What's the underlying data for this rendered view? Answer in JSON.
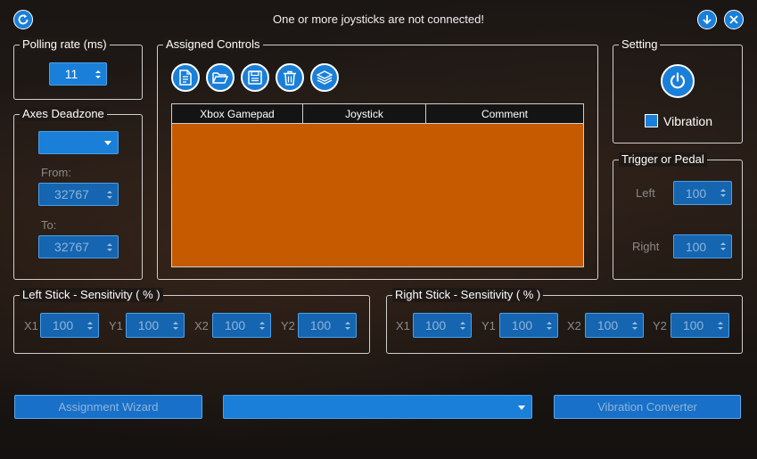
{
  "window": {
    "status_message": "One or more joysticks are not connected!"
  },
  "polling": {
    "title": "Polling rate (ms)",
    "value": "11"
  },
  "deadzone": {
    "title": "Axes Deadzone",
    "combo_value": "",
    "from_label": "From:",
    "from_value": "32767",
    "to_label": "To:",
    "to_value": "32767"
  },
  "assigned": {
    "title": "Assigned Controls",
    "toolbar": [
      {
        "icon": "new-document-icon"
      },
      {
        "icon": "open-folder-icon"
      },
      {
        "icon": "save-icon"
      },
      {
        "icon": "delete-icon"
      },
      {
        "icon": "layers-icon"
      }
    ],
    "columns": [
      "Xbox Gamepad",
      "Joystick",
      "Comment"
    ],
    "rows": []
  },
  "setting": {
    "title": "Setting",
    "vibration_label": "Vibration",
    "vibration_checked": false
  },
  "trigger": {
    "title": "Trigger or Pedal",
    "left_label": "Left",
    "left_value": "100",
    "right_label": "Right",
    "right_value": "100"
  },
  "left_stick": {
    "title": "Left Stick - Sensitivity ( % )",
    "fields": [
      {
        "label": "X1",
        "value": "100"
      },
      {
        "label": "Y1",
        "value": "100"
      },
      {
        "label": "X2",
        "value": "100"
      },
      {
        "label": "Y2",
        "value": "100"
      }
    ]
  },
  "right_stick": {
    "title": "Right Stick - Sensitivity ( % )",
    "fields": [
      {
        "label": "X1",
        "value": "100"
      },
      {
        "label": "Y1",
        "value": "100"
      },
      {
        "label": "X2",
        "value": "100"
      },
      {
        "label": "Y2",
        "value": "100"
      }
    ]
  },
  "bottom": {
    "wizard_label": "Assignment Wizard",
    "combo_value": "",
    "converter_label": "Vibration Converter"
  },
  "colors": {
    "accent": "#1a7fd8",
    "grid_body": "#c55a00"
  }
}
